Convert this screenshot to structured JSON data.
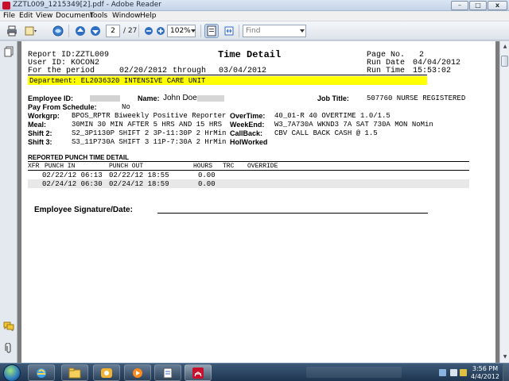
{
  "window": {
    "title": "ZZTL009_1215349[2].pdf - Adobe Reader",
    "min_glyph": "–",
    "max_glyph": "□",
    "close_glyph": "x"
  },
  "menu": [
    "File",
    "Edit",
    "View",
    "Document",
    "Tools",
    "Window",
    "Help"
  ],
  "toolbar": {
    "page_current": "2",
    "page_total": "/ 27",
    "zoom": "102%",
    "find_placeholder": "Find"
  },
  "report": {
    "report_id": "Report ID:ZZTL009",
    "title": "Time Detail",
    "page_label": "Page No.",
    "page_value": "2",
    "user_id": "User ID: KOCON2",
    "run_date_label": "Run Date",
    "run_date": "04/04/2012",
    "period_label": "For the period",
    "period_start": "02/20/2012",
    "through_label": "through",
    "period_end": "03/04/2012",
    "run_time_label": "Run Time",
    "run_time": "15:53:02",
    "department": "Department: EL2036320 INTENSIVE CARE UNIT"
  },
  "employee": {
    "id_label": "Employee ID:",
    "name_label": "Name:",
    "name": "John Doe",
    "job_label": "Job Title:",
    "job": "507760 NURSE REGISTERED",
    "pay_label": "Pay From Schedule:",
    "pay_value": "No",
    "workgrp_label": "Workgrp:",
    "workgrp": "BPOS_RPTR Biweekly Positive Reporter",
    "overtime_label": "OverTime:",
    "overtime": "40_01-R 40 OVERTIME 1.0/1.5",
    "meal_label": "Meal:",
    "meal": "30MIN 30 MIN AFTER 5 HRS AND 15 HRS",
    "weekend_label": "WeekEnd:",
    "weekend": "W3_7A730A WKND3 7A SAT 730A MON NoMin",
    "shift2_label": "Shift 2:",
    "shift2": "S2_3P1130P SHIFT 2 3P-11:30P 2 HrMin",
    "callback_label": "CallBack:",
    "callback": "CBV CALL BACK CASH @ 1.5",
    "shift3_label": "Shift 3:",
    "shift3": "S3_11P730A SHIFT 3 11P-7:30A 2 HrMin",
    "holworked_label": "HolWorked"
  },
  "punch": {
    "section_title": "REPORTED PUNCH TIME DETAIL",
    "headers": {
      "xfr": "XFR",
      "in": "PUNCH IN",
      "out": "PUNCH OUT",
      "hours": "HOURS",
      "trc": "TRC",
      "override": "OVERRIDE"
    },
    "rows": [
      {
        "in": "02/22/12 06:13",
        "out": "02/22/12 18:55",
        "hours": "0.00"
      },
      {
        "in": "02/24/12 06:30",
        "out": "02/24/12 18:59",
        "hours": "0.00"
      }
    ]
  },
  "signature": {
    "label": "Employee Signature/Date:"
  },
  "tray": {
    "time": "3:56 PM",
    "date": "4/4/2012"
  },
  "colors": {
    "highlight": "#ffff00",
    "acrobat_red": "#c8102e"
  }
}
